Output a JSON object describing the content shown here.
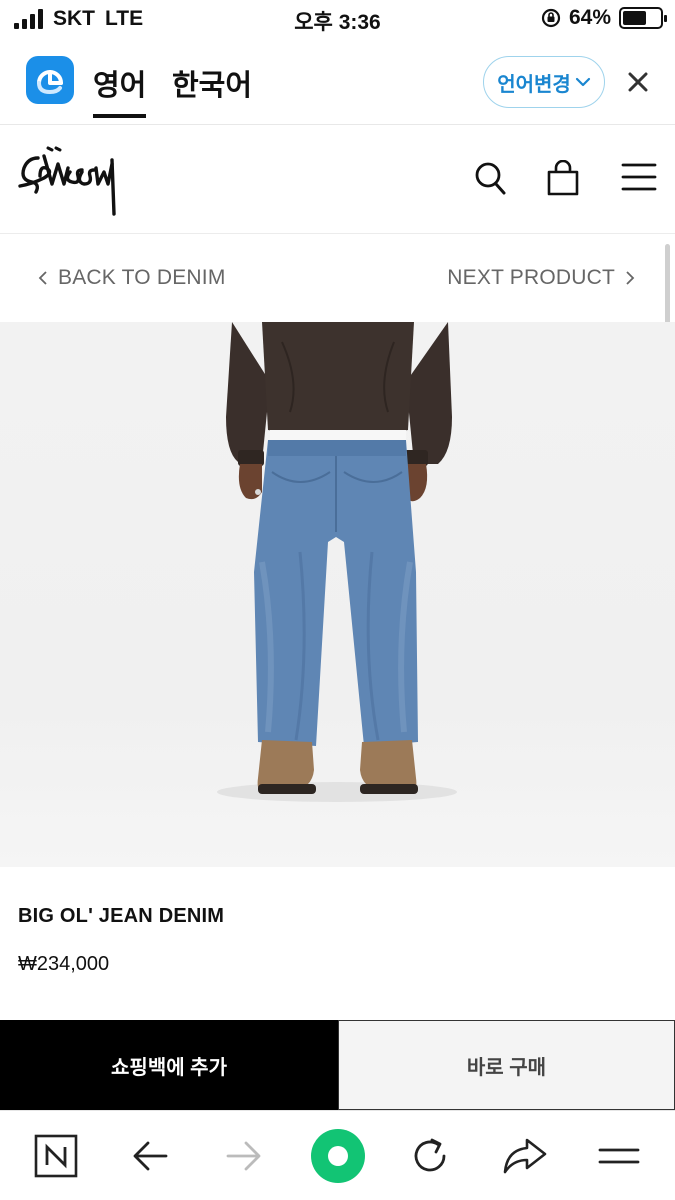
{
  "status_bar": {
    "carrier": "SKT",
    "network": "LTE",
    "time": "오후 3:36",
    "battery_percent": "64%",
    "battery_level": 0.64
  },
  "translate_bar": {
    "tab_active": "영어",
    "tab_second": "한국어",
    "language_button": "언어변경",
    "accent_color": "#1b8fe8"
  },
  "site_header": {
    "icons": [
      "search-icon",
      "shopping-bag-icon",
      "menu-icon"
    ]
  },
  "product_nav": {
    "back_label": "BACK TO DENIM",
    "next_label": "NEXT PRODUCT"
  },
  "product": {
    "name": "BIG OL' JEAN DENIM",
    "price": "₩234,000"
  },
  "actions": {
    "add_to_bag": "쇼핑백에 추가",
    "buy_now": "바로 구매"
  },
  "browser_bar": {
    "icons": [
      "naver-home-icon",
      "back-arrow-icon",
      "forward-arrow-icon",
      "green-dot-icon",
      "reload-icon",
      "share-icon",
      "menu-icon"
    ],
    "accent_color": "#12c474"
  }
}
